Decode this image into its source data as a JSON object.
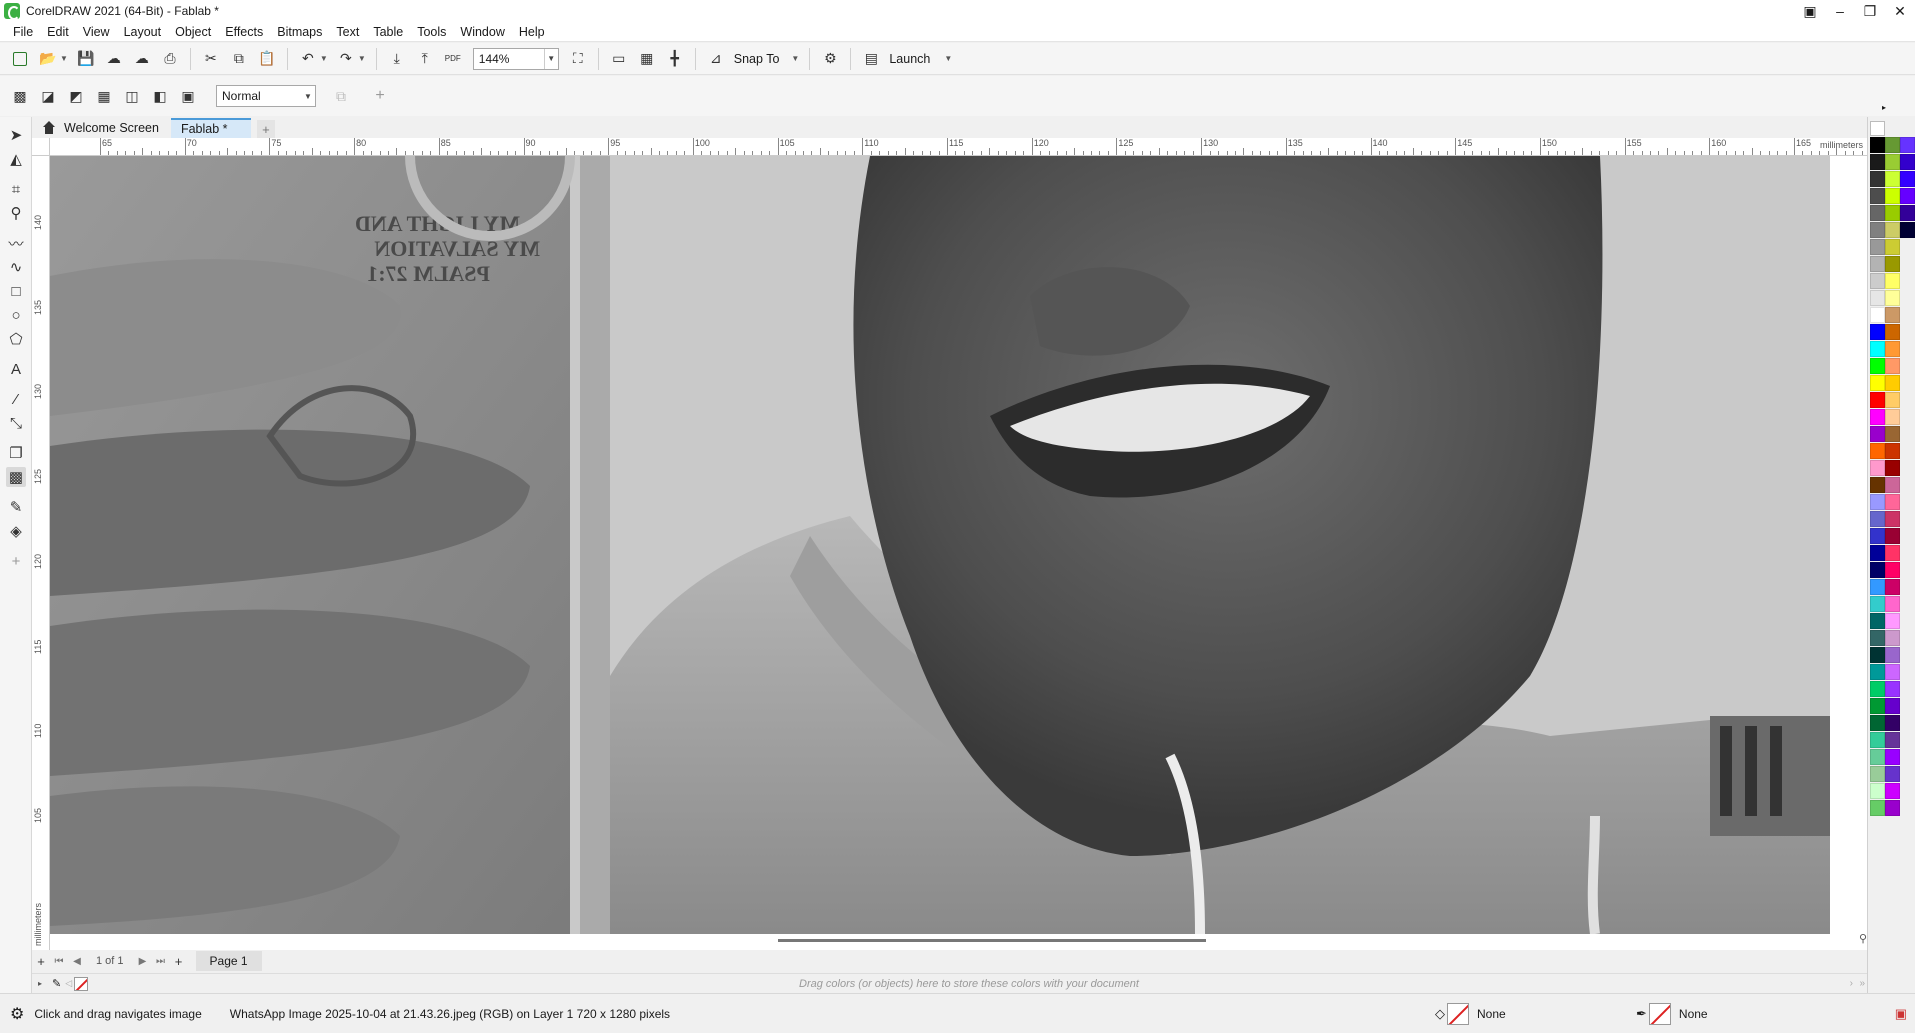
{
  "window": {
    "title": "CorelDRAW 2021 (64-Bit) - Fablab *",
    "controls": {
      "minimize": "–",
      "restore": "❐",
      "close": "✕"
    }
  },
  "menubar": {
    "items": [
      "File",
      "Edit",
      "View",
      "Layout",
      "Object",
      "Effects",
      "Bitmaps",
      "Text",
      "Table",
      "Tools",
      "Window",
      "Help"
    ]
  },
  "toolbar": {
    "zoom_value": "144%",
    "snap_label": "Snap To",
    "launch_label": "Launch",
    "pdf_label": "PDF"
  },
  "property_bar": {
    "blend_mode": "Normal",
    "add_label": "+"
  },
  "tabs": {
    "welcome": "Welcome Screen",
    "document": "Fablab *",
    "add": "+"
  },
  "ruler": {
    "unit": "millimeters",
    "h_labels": [
      "65",
      "70",
      "75",
      "80",
      "85",
      "90",
      "95",
      "100",
      "105",
      "110",
      "115",
      "120",
      "125",
      "130",
      "135",
      "140",
      "145",
      "150",
      "155",
      "160",
      "165"
    ],
    "v_labels": [
      "140",
      "135",
      "130",
      "125",
      "120",
      "115",
      "110",
      "105"
    ],
    "v_unit": "millimeters"
  },
  "page_nav": {
    "add": "+",
    "counter": "1 of 1",
    "add_after": "+",
    "page_tab": "Page 1"
  },
  "color_docker": {
    "hint": "Drag colors (or objects) here to store these colors with your document"
  },
  "status": {
    "tip": "Click and drag navigates image",
    "object_info": "WhatsApp Image 2025-10-04 at 21.43.26.jpeg (RGB) on Layer 1 720 x 1280 pixels",
    "fill_label": "None",
    "outline_label": "None"
  },
  "palette": {
    "col1": [
      "#000000",
      "#1a1a1a",
      "#333333",
      "#4d4d4d",
      "#666666",
      "#808080",
      "#999999",
      "#b3b3b3",
      "#cccccc",
      "#e6e6e6",
      "#ffffff",
      "#0000ff",
      "#00ffff",
      "#00ff00",
      "#ffff00",
      "#ff0000",
      "#ff00ff",
      "#9900cc",
      "#ff6600",
      "#ff99cc",
      "#663300",
      "#9999ff",
      "#6666cc",
      "#3333cc",
      "#000099",
      "#000066",
      "#3399ff",
      "#33cccc",
      "#006666",
      "#336666",
      "#003333",
      "#009999",
      "#00cc66",
      "#009933",
      "#006633",
      "#33cc99",
      "#66cc99",
      "#99cc99",
      "#ccffcc",
      "#66cc66"
    ],
    "col2": [
      "#669933",
      "#99cc33",
      "#ccff33",
      "#ccff00",
      "#99cc00",
      "#cccc66",
      "#cccc33",
      "#999900",
      "#ffff66",
      "#ffff99",
      "#cc9966",
      "#cc6600",
      "#ff9933",
      "#ff9966",
      "#ffcc00",
      "#ffcc66",
      "#ffcc99",
      "#996633",
      "#cc3300",
      "#990000",
      "#cc6699",
      "#ff6699",
      "#cc3366",
      "#990033",
      "#ff3366",
      "#ff0066",
      "#cc0066",
      "#ff66cc",
      "#ff99ff",
      "#cc99cc",
      "#9966cc",
      "#cc66ff",
      "#9933ff",
      "#6600cc",
      "#330066",
      "#663399",
      "#9900ff",
      "#6633cc",
      "#cc00ff",
      "#9900cc"
    ],
    "col3": [
      "#6633ff",
      "#3300cc",
      "#3300ff",
      "#6600ff",
      "#330099",
      "#000033"
    ]
  }
}
